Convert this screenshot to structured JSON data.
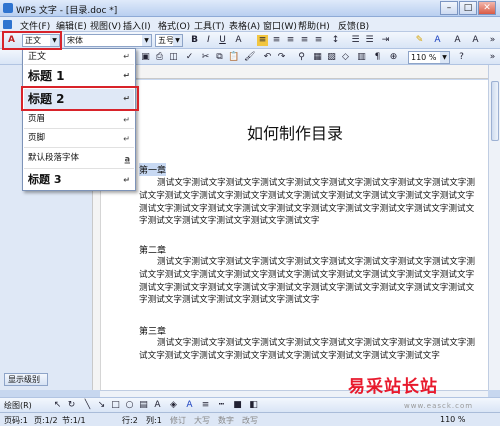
{
  "window": {
    "title": "WPS 文字 - [目录.doc *]"
  },
  "menubar": {
    "items": [
      "文件(F)",
      "编辑(E)",
      "视图(V)",
      "插入(I)",
      "格式(O)",
      "工具(T)",
      "表格(A)",
      "窗口(W)",
      "帮助(H)",
      "反馈(B)"
    ]
  },
  "toolbar": {
    "style_value": "正文",
    "font_value": "宋体",
    "size_value": "五号",
    "zoom_value": "110 %"
  },
  "style_dropdown": {
    "items": [
      {
        "label": "正文"
      },
      {
        "label": "标题 1"
      },
      {
        "label": "标题 2"
      },
      {
        "label": "页眉"
      },
      {
        "label": "页脚"
      },
      {
        "label": "默认段落字体",
        "mark": "a"
      },
      {
        "label": "标题 3"
      }
    ],
    "return_symbol": "↵"
  },
  "left_pane": {
    "button_label": "显示级别"
  },
  "document": {
    "title": "如何制作目录",
    "chapters": [
      {
        "heading": "第一章",
        "text": "测试文字测试文字测试文字测试文字测试文字测试文字测试文字测试文字测试文字测试文字测试文字测试文字测试文字测试文字测试文字测试文字测试文字测试文字测试文字测试文字测试文字测试文字测试文字测试文字测试文字测试文字测试文字测试文字测试文字测试文字测试文字测试文字测试文字测试文字"
      },
      {
        "heading": "第二章",
        "text": "测试文字测试文字测试文字测试文字测试文字测试文字测试文字测试文字测试文字测试文字测试文字测试文字测试文字测试文字测试文字测试文字测试文字测试文字测试文字测试文字测试文字测试文字测试文字测试文字测试文字测试文字测试文字测试文字测试文字测试文字测试文字测试文字测试文字测试文字"
      },
      {
        "heading": "第三章",
        "text": "测试文字测试文字测试文字测试文字测试文字测试文字测试文字测试文字测试文字测试文字测试文字测试文字测试文字测试文字测试文字测试文字测试文字测试文字"
      }
    ]
  },
  "drawbar": {
    "label": "绘图(R)"
  },
  "statusbar": {
    "page_count": "页码:1",
    "page": "页:1/2",
    "section": "节:1/1",
    "row": "行:2",
    "col": "列:1",
    "modes": [
      "修订",
      "大写",
      "数字",
      "改写"
    ],
    "zoom": "110 %"
  },
  "watermark": {
    "text": "易采站长站",
    "url": "www.easck.com"
  }
}
